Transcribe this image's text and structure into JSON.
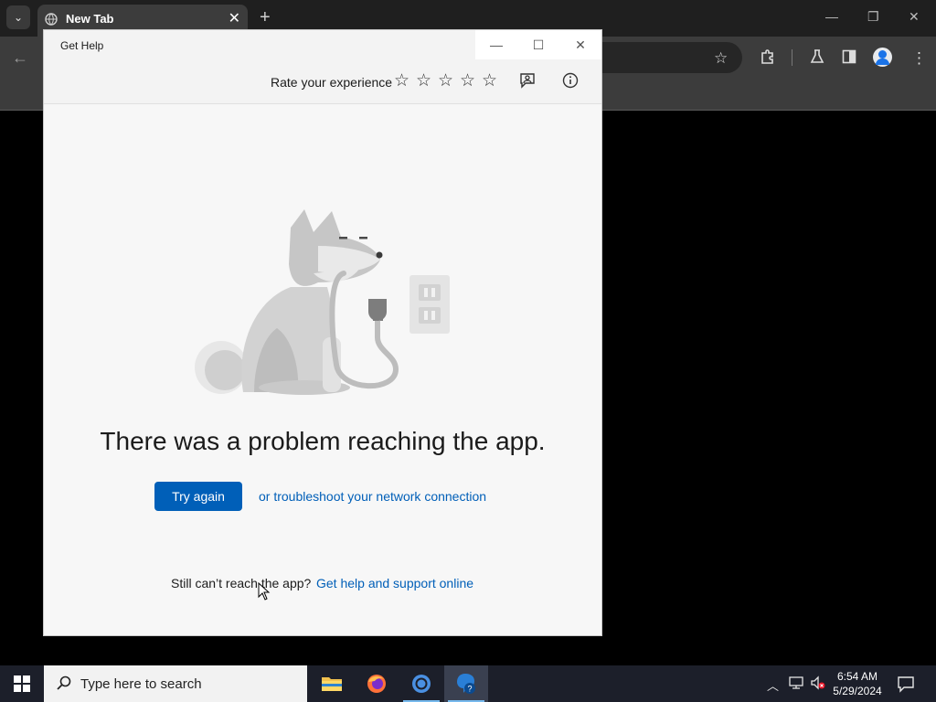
{
  "chrome": {
    "tab_title": "New Tab",
    "tab_close": "✕",
    "new_tab": "+",
    "tab_list": "⌄",
    "back": "←"
  },
  "get_help": {
    "window_title": "Get Help",
    "rate_label": "Rate your experience",
    "stars": [
      "☆",
      "☆",
      "☆",
      "☆",
      "☆"
    ],
    "heading": "There was a problem reaching the app.",
    "try_again": "Try again",
    "troubleshoot_link": "or troubleshoot your network connection",
    "still_text": "Still can’t reach the app?",
    "help_link": "Get help and support online",
    "icons": [
      "feedback-icon",
      "info-icon"
    ]
  },
  "taskbar": {
    "search_placeholder": "Type here to search",
    "time": "6:54 AM",
    "date": "5/29/2024",
    "apps": [
      "file-explorer",
      "firefox",
      "chrome",
      "get-help"
    ]
  },
  "colors": {
    "accent": "#005fb8",
    "taskbar": "#1c1f2a",
    "chrome_toolbar": "#3c3c3c"
  }
}
